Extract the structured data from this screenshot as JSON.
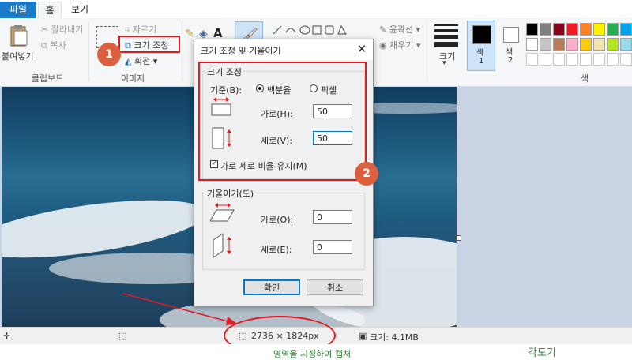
{
  "tabs": {
    "file": "파일",
    "home": "홈",
    "view": "보기"
  },
  "clipboard": {
    "paste": "붙여넣기",
    "cut": "잘라내기",
    "copy": "복사",
    "label": "클립보드"
  },
  "image": {
    "crop": "자르기",
    "resize": "크기 조정",
    "rotate": "회전",
    "label": "이미지"
  },
  "shapes": {
    "outline": "윤곽선",
    "fill": "채우기"
  },
  "size": {
    "label": "크기"
  },
  "colors": {
    "color1": "색\n1",
    "color1_a": "색",
    "color1_b": "1",
    "color2_a": "색",
    "color2_b": "2",
    "label": "색",
    "palette_row1": [
      "#000000",
      "#7f7f7f",
      "#880015",
      "#ed1c24",
      "#ff7f27",
      "#fff200",
      "#22b14c",
      "#00a2e8",
      "#3f48cc"
    ],
    "palette_row2": [
      "#ffffff",
      "#c3c3c3",
      "#b97a57",
      "#ffaec9",
      "#ffc90e",
      "#efe4b0",
      "#b5e61d",
      "#99d9ea",
      "#7092be"
    ]
  },
  "dialog": {
    "title": "크기 조정 및 기울이기",
    "resize_legend": "크기 조정",
    "by_label": "기준(B):",
    "percent_option": "백분율",
    "pixel_option": "픽셀",
    "horizontal_label": "가로(H):",
    "horizontal_value": "50",
    "vertical_label": "세로(V):",
    "vertical_value": "50",
    "aspect_label": "가로 세로 비율 유지(M)",
    "skew_legend": "기울이기(도)",
    "skew_h_label": "가로(O):",
    "skew_h_value": "0",
    "skew_v_label": "세로(E):",
    "skew_v_value": "0",
    "ok": "확인",
    "cancel": "취소"
  },
  "status": {
    "dimensions": "2736 × 1824px",
    "file_size": "크기: 4.1MB"
  },
  "below": {
    "capture_text": "영역을 지정하여 캡처",
    "angle_text": "각도기"
  },
  "annotations": {
    "badge1": "1",
    "badge2": "2"
  }
}
